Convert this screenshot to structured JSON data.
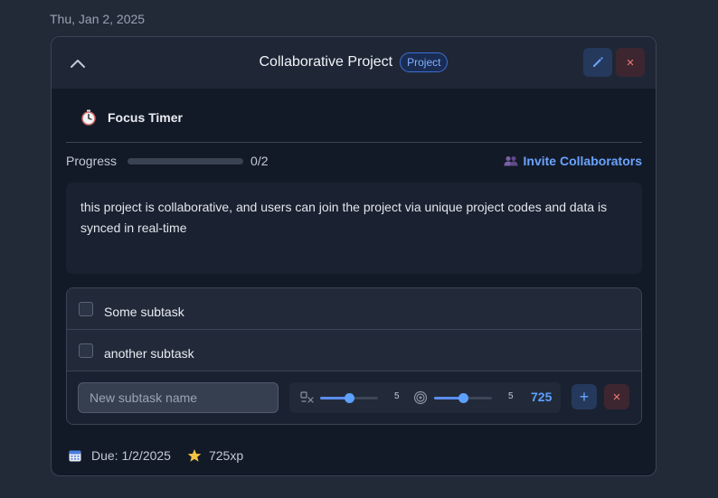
{
  "date_header": "Thu, Jan 2, 2025",
  "task": {
    "title": "Collaborative Project",
    "badge": "Project",
    "edit_icon": "pencil-icon",
    "delete_icon": "close-icon",
    "delete_label": "×"
  },
  "focus_timer": {
    "icon": "stopwatch-icon",
    "label": "Focus Timer"
  },
  "progress": {
    "label": "Progress",
    "completed": 0,
    "total": 2,
    "text": "0/2"
  },
  "invite": {
    "icon": "people-icon",
    "label": "Invite Collaborators"
  },
  "description": "this project is collaborative, and users can join the project via unique project codes and data is synced in real-time",
  "subtasks": [
    {
      "label": "Some subtask",
      "checked": false
    },
    {
      "label": "another subtask",
      "checked": false
    }
  ],
  "new_subtask": {
    "placeholder": "New subtask name",
    "difficulty_icon": "difficulty-icon",
    "difficulty_value": "5",
    "difficulty_level": 0.5,
    "importance_icon": "target-icon",
    "importance_value": "5",
    "importance_level": 0.5,
    "xp_total": "725",
    "add_label": "+",
    "cancel_label": "×"
  },
  "footer": {
    "calendar_icon": "calendar-icon",
    "due_text": "Due: 1/2/2025",
    "star_icon": "star-icon",
    "xp_text": "725xp"
  },
  "colors": {
    "accent": "#5ea0ff",
    "danger": "#f07b7b",
    "background": "#222a38",
    "card": "#131a27"
  }
}
